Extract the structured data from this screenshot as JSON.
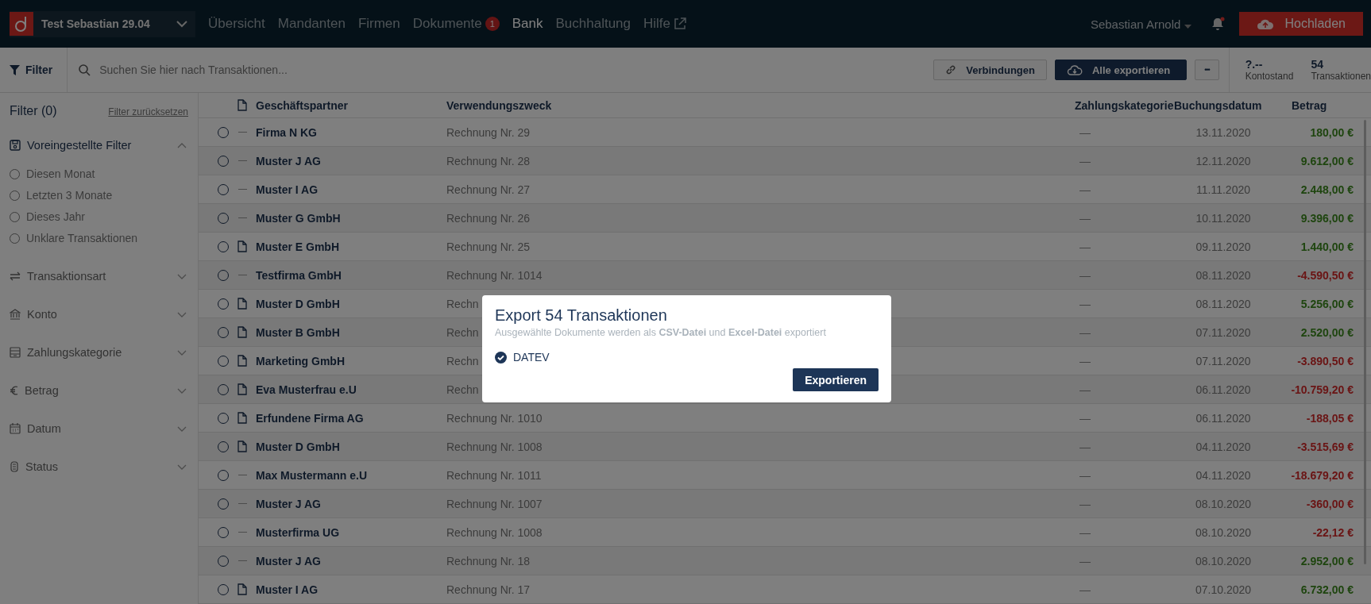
{
  "header": {
    "company": "Test Sebastian 29.04",
    "nav": [
      {
        "label": "Übersicht",
        "selected": false
      },
      {
        "label": "Mandanten",
        "selected": false
      },
      {
        "label": "Firmen",
        "selected": false
      },
      {
        "label": "Dokumente",
        "selected": false,
        "badge": "1"
      },
      {
        "label": "Bank",
        "selected": true
      },
      {
        "label": "Buchhaltung",
        "selected": false
      },
      {
        "label": "Hilfe",
        "selected": false,
        "external": true
      }
    ],
    "user": "Sebastian Arnold",
    "notification": true,
    "upload_button": "Hochladen"
  },
  "toolbar": {
    "filter_button": "Filter",
    "search": {
      "placeholder": "Suchen Sie hier nach Transaktionen..."
    },
    "connections_button": "Verbindungen",
    "export_all_button": "Alle exportieren",
    "more_button": "•••",
    "stats": [
      {
        "value": "?.--",
        "label": "Kontostand"
      },
      {
        "value": "54",
        "label": "Transaktionen"
      }
    ]
  },
  "sidebar": {
    "title": "Filter (0)",
    "reset_link": "Filter zurücksetzen",
    "sections": [
      {
        "label": "Voreingestellte Filter",
        "kind": "preset",
        "expanded": true,
        "options": [
          {
            "label": "Diesen Monat",
            "selected": false
          },
          {
            "label": "Letzten 3 Monate",
            "selected": false
          },
          {
            "label": "Dieses Jahr",
            "selected": false
          },
          {
            "label": "Unklare Transaktionen",
            "selected": false
          }
        ]
      },
      {
        "label": "Transaktionsart",
        "kind": "transfer",
        "expanded": false
      },
      {
        "label": "Konto",
        "kind": "bank",
        "expanded": false
      },
      {
        "label": "Zahlungskategorie",
        "kind": "category",
        "expanded": false
      },
      {
        "label": "Betrag",
        "kind": "euro",
        "expanded": false
      },
      {
        "label": "Datum",
        "kind": "calendar",
        "expanded": false
      },
      {
        "label": "Status",
        "kind": "status",
        "expanded": false
      }
    ]
  },
  "table": {
    "columns": [
      "Geschäftspartner",
      "Verwendungszweck",
      "Zahlungskategorie",
      "Buchungsdatum",
      "Betrag"
    ],
    "rows": [
      {
        "selected": false,
        "document": false,
        "partner": "Firma N KG",
        "purpose": "Rechnung Nr. 29",
        "category": "—",
        "date": "13.11.2020",
        "amount": "180,00 €",
        "kind": "credit"
      },
      {
        "selected": false,
        "document": false,
        "partner": "Muster J AG",
        "purpose": "Rechnung Nr. 28",
        "category": "—",
        "date": "12.11.2020",
        "amount": "9.612,00 €",
        "kind": "credit"
      },
      {
        "selected": false,
        "document": false,
        "partner": "Muster I AG",
        "purpose": "Rechnung Nr. 27",
        "category": "—",
        "date": "11.11.2020",
        "amount": "2.448,00 €",
        "kind": "credit"
      },
      {
        "selected": false,
        "document": false,
        "partner": "Muster G GmbH",
        "purpose": "Rechnung Nr. 26",
        "category": "—",
        "date": "10.11.2020",
        "amount": "9.396,00 €",
        "kind": "credit"
      },
      {
        "selected": false,
        "document": true,
        "partner": "Muster E GmbH",
        "purpose": "Rechnung Nr. 25",
        "category": "—",
        "date": "09.11.2020",
        "amount": "1.440,00 €",
        "kind": "credit"
      },
      {
        "selected": false,
        "document": false,
        "partner": "Testfirma GmbH",
        "purpose": "Rechnung Nr. 1014",
        "category": "—",
        "date": "08.11.2020",
        "amount": "-4.590,50 €",
        "kind": "debit"
      },
      {
        "selected": false,
        "document": true,
        "partner": "Muster D GmbH",
        "purpose": "Rechn",
        "category": "—",
        "date": "08.11.2020",
        "amount": "5.256,00 €",
        "kind": "credit"
      },
      {
        "selected": false,
        "document": true,
        "partner": "Muster B GmbH",
        "purpose": "Rechn",
        "category": "—",
        "date": "07.11.2020",
        "amount": "2.520,00 €",
        "kind": "credit"
      },
      {
        "selected": false,
        "document": true,
        "partner": "Marketing GmbH",
        "purpose": "Rechn",
        "category": "—",
        "date": "07.11.2020",
        "amount": "-3.890,50 €",
        "kind": "debit"
      },
      {
        "selected": false,
        "document": true,
        "partner": "Eva Musterfrau e.U",
        "purpose": "Rechn",
        "category": "—",
        "date": "06.11.2020",
        "amount": "-10.759,20 €",
        "kind": "debit"
      },
      {
        "selected": false,
        "document": true,
        "partner": "Erfundene Firma AG",
        "purpose": "Rechnung Nr. 1010",
        "category": "—",
        "date": "06.11.2020",
        "amount": "-188,05 €",
        "kind": "debit"
      },
      {
        "selected": false,
        "document": true,
        "partner": "Muster D GmbH",
        "purpose": "Rechnung Nr. 1008",
        "category": "—",
        "date": "04.11.2020",
        "amount": "-3.515,69 €",
        "kind": "debit"
      },
      {
        "selected": false,
        "document": false,
        "partner": "Max Mustermann e.U",
        "purpose": "Rechnung Nr. 1011",
        "category": "—",
        "date": "04.11.2020",
        "amount": "-18.679,20 €",
        "kind": "debit"
      },
      {
        "selected": false,
        "document": false,
        "partner": "Muster J AG",
        "purpose": "Rechnung Nr. 1007",
        "category": "—",
        "date": "08.10.2020",
        "amount": "-360,00 €",
        "kind": "debit"
      },
      {
        "selected": false,
        "document": false,
        "partner": "Musterfirma UG",
        "purpose": "Rechnung Nr. 1008",
        "category": "—",
        "date": "08.10.2020",
        "amount": "-22,12 €",
        "kind": "debit"
      },
      {
        "selected": false,
        "document": false,
        "partner": "Muster J AG",
        "purpose": "Rechnung Nr. 18",
        "category": "—",
        "date": "08.10.2020",
        "amount": "2.952,00 €",
        "kind": "credit"
      },
      {
        "selected": false,
        "document": true,
        "partner": "Muster I AG",
        "purpose": "Rechnung Nr. 17",
        "category": "—",
        "date": "07.10.2020",
        "amount": "6.732,00 €",
        "kind": "credit"
      }
    ]
  },
  "dialog": {
    "title": "Export 54 Transaktionen",
    "subtitle": "Ausgewählte Dokumente werden als **CSV-Datei** und **Excel-Datei** exportiert",
    "options": [
      {
        "label": "DATEV",
        "checked": true
      }
    ],
    "button": "Exportieren"
  }
}
